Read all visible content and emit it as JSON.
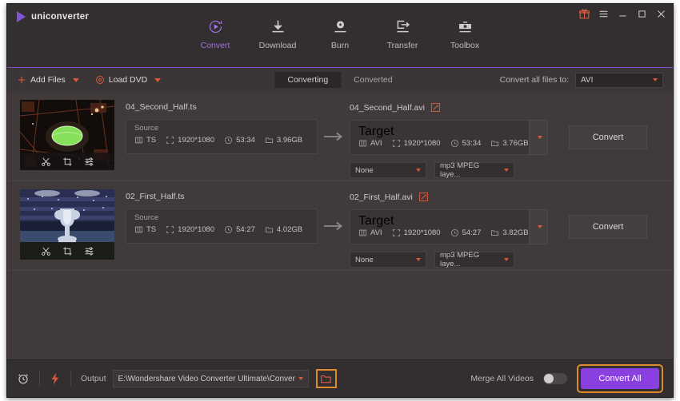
{
  "app": {
    "name": "uniconverter"
  },
  "window_controls": [
    {
      "name": "gift-icon",
      "label": ""
    },
    {
      "name": "menu-icon",
      "label": ""
    },
    {
      "name": "minimize-button",
      "label": ""
    },
    {
      "name": "maximize-button",
      "label": ""
    },
    {
      "name": "close-button",
      "label": ""
    }
  ],
  "nav": {
    "tabs": [
      {
        "label": "Convert",
        "icon": "convert-icon",
        "active": true
      },
      {
        "label": "Download",
        "icon": "download-icon",
        "active": false
      },
      {
        "label": "Burn",
        "icon": "burn-icon",
        "active": false
      },
      {
        "label": "Transfer",
        "icon": "transfer-icon",
        "active": false
      },
      {
        "label": "Toolbox",
        "icon": "toolbox-icon",
        "active": false
      }
    ]
  },
  "toolbar": {
    "add_files": "Add Files",
    "load_dvd": "Load DVD",
    "segments": [
      {
        "label": "Converting",
        "active": true
      },
      {
        "label": "Converted",
        "active": false
      }
    ],
    "convert_all_to_label": "Convert all files to:",
    "convert_all_to_value": "AVI"
  },
  "files": [
    {
      "source_name": "04_Second_Half.ts",
      "target_name": "04_Second_Half.avi",
      "source_caption": "Source",
      "target_caption": "Target",
      "source": {
        "format": "TS",
        "resolution": "1920*1080",
        "duration": "53:34",
        "size": "3.96GB"
      },
      "target": {
        "format": "AVI",
        "resolution": "1920*1080",
        "duration": "53:34",
        "size": "3.76GB"
      },
      "subtitle": "None",
      "audio": "mp3 MPEG laye...",
      "convert_label": "Convert",
      "thumb_kind": "stadium-aerial"
    },
    {
      "source_name": "02_First_Half.ts",
      "target_name": "02_First_Half.avi",
      "source_caption": "Source",
      "target_caption": "Target",
      "source": {
        "format": "TS",
        "resolution": "1920*1080",
        "duration": "54:27",
        "size": "4.02GB"
      },
      "target": {
        "format": "AVI",
        "resolution": "1920*1080",
        "duration": "54:27",
        "size": "3.82GB"
      },
      "subtitle": "None",
      "audio": "mp3 MPEG laye...",
      "convert_label": "Convert",
      "thumb_kind": "trophy"
    }
  ],
  "thumb_tools": [
    {
      "name": "trim-icon"
    },
    {
      "name": "crop-icon"
    },
    {
      "name": "effect-icon"
    }
  ],
  "bottom": {
    "output_label": "Output",
    "output_path": "E:\\Wondershare Video Converter Ultimate\\Converted",
    "merge_label": "Merge All Videos",
    "merge_on": false,
    "convert_all_label": "Convert All"
  },
  "colors": {
    "accent_purple": "#8a3fe0",
    "nav_active": "#9d72e0",
    "caret_red": "#d9583b",
    "highlight_orange": "#e08a2e",
    "chrome_bg": "#332f30",
    "list_bg": "#403a3b"
  }
}
